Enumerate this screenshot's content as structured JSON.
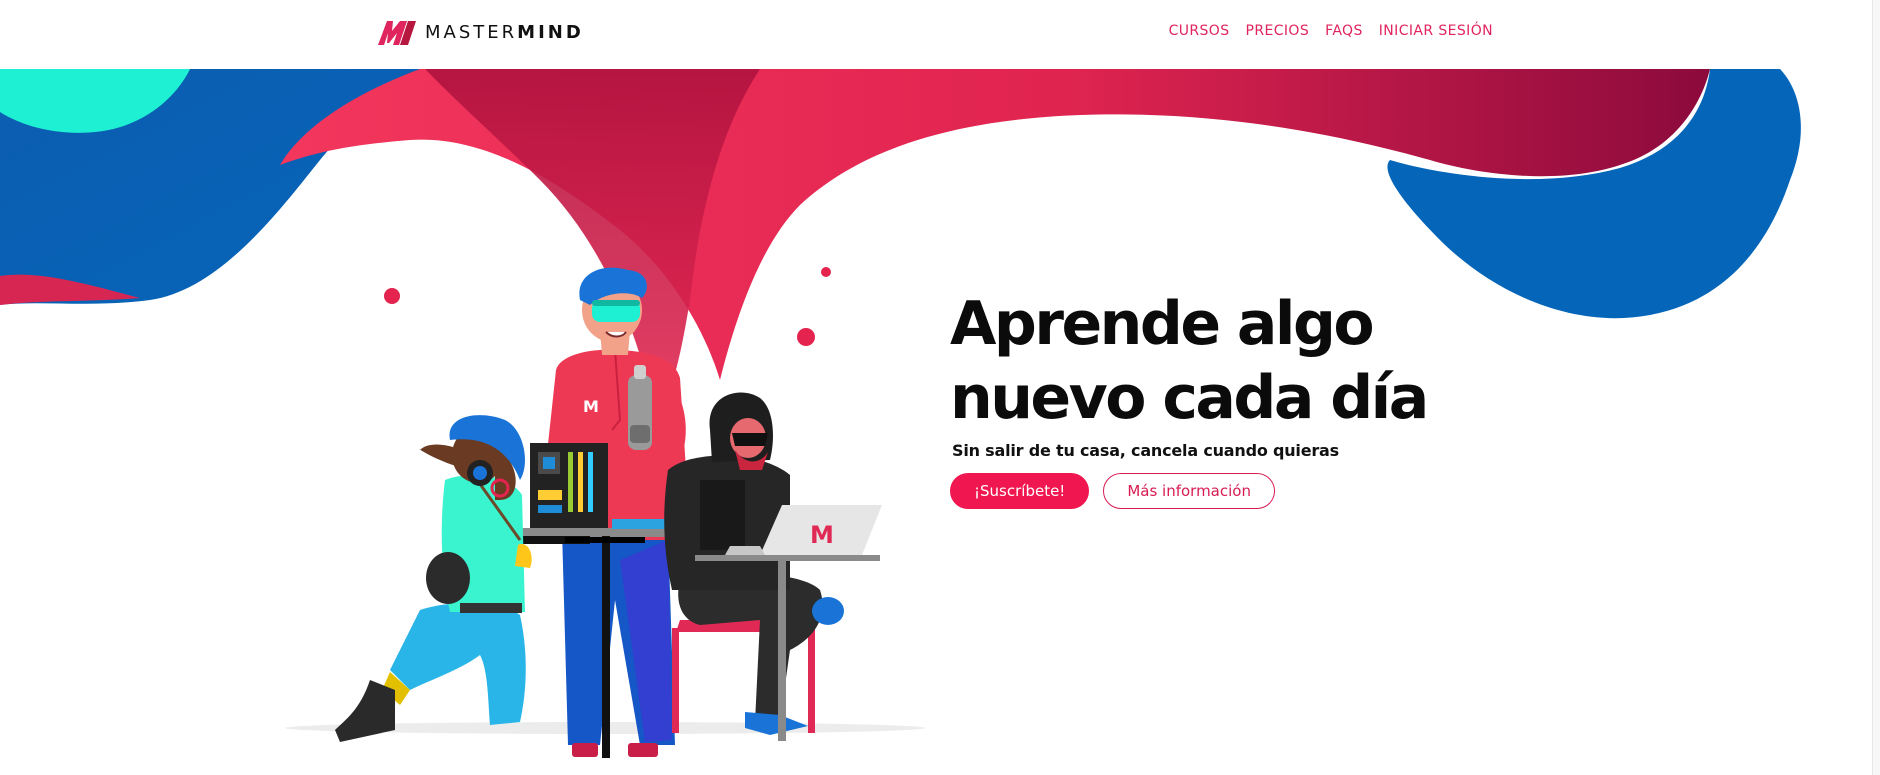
{
  "header": {
    "logo": {
      "text_light": "MASTER",
      "text_bold": "MIND",
      "mark_icon": "mastermind-logo-icon"
    },
    "nav": [
      {
        "label": "CURSOS"
      },
      {
        "label": "PRECIOS"
      },
      {
        "label": "FAQS"
      },
      {
        "label": "INICIAR SESIÓN"
      }
    ]
  },
  "hero": {
    "title_line1": "Aprende algo",
    "title_line2": "nuevo cada día",
    "subtitle": "Sin salir de tu casa, cancela cuando quieras",
    "primary_cta": "¡Suscríbete!",
    "secondary_cta": "Más información"
  },
  "illustration": {
    "description_icon": "students-learning-illustration",
    "shirt_logo_icon": "mastermind-shirt-logo-icon",
    "laptop_logo_icon": "mastermind-laptop-logo-icon"
  },
  "colors": {
    "brand_pink": "#e0245e",
    "button_pink": "#f0164f",
    "blob_blue": "#0a63b5",
    "blob_red": "#e52a53",
    "blob_cyan": "#1ef0d4"
  }
}
